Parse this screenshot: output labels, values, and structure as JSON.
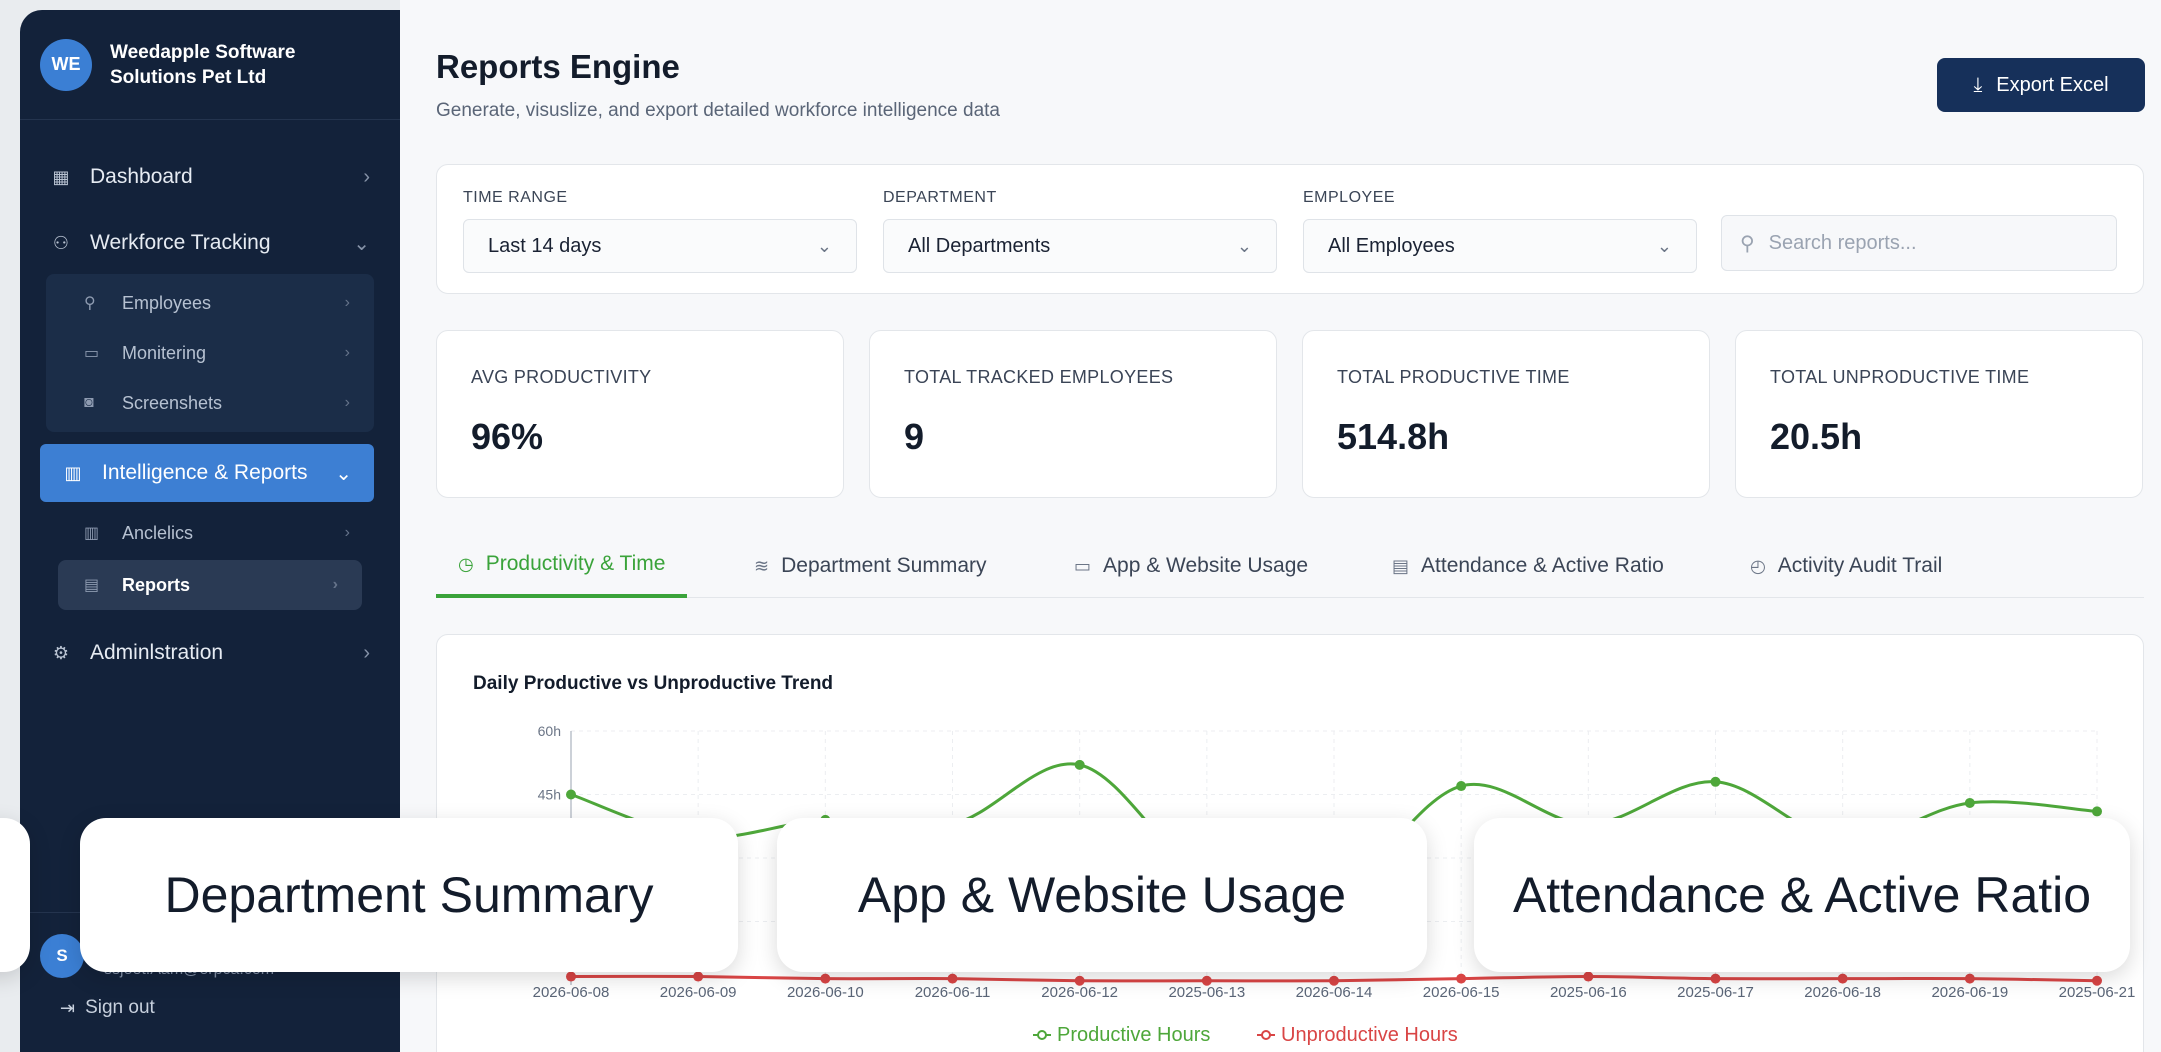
{
  "brand": {
    "logo": "WE",
    "name": "Weedapple Software Solutions Pet Ltd"
  },
  "nav": {
    "dashboard": "Dashboard",
    "workforce": "Werkforce Tracking",
    "employees": "Employees",
    "monitoring": "Monitering",
    "screenshots": "Screenshets",
    "intelligence": "Intelligence & Reports",
    "analytics": "Anclelics",
    "reports": "Reports",
    "administration": "Adminlstration"
  },
  "user": {
    "avatar": "S",
    "email": "ssjeet.Aam@erpca.com",
    "signout": "Sign out"
  },
  "header": {
    "title": "Reports Engine",
    "subtitle": "Generate, visuslize, and export detailed workforce intelligence data",
    "export": "Export Excel"
  },
  "filters": {
    "time_label": "TIME RANGE",
    "time_value": "Last 14 days",
    "dept_label": "DEPARTMENT",
    "dept_value": "All Departments",
    "emp_label": "EMPLOYEE",
    "emp_value": "All Employees",
    "search_placeholder": "Search reports..."
  },
  "stats": [
    {
      "label": "AVG PRODUCTIVITY",
      "value": "96%"
    },
    {
      "label": "TOTAL TRACKED EMPLOYEES",
      "value": "9"
    },
    {
      "label": "TOTAL PRODUCTIVE TIME",
      "value": "514.8h"
    },
    {
      "label": "TOTAL UNPRODUCTIVE TIME",
      "value": "20.5h"
    }
  ],
  "tabs": [
    "Productivity & Time",
    "Department Summary",
    "App & Website Usage",
    "Attendance & Active Ratio",
    "Activity Audit Trail"
  ],
  "overlay": [
    "Department Summary",
    "App & Website Usage",
    "Attendance & Active Ratio"
  ],
  "colors": {
    "productive": "#4ea73a",
    "unproductive": "#d94545",
    "accent": "#3d7fd3"
  },
  "chart_data": {
    "type": "line",
    "title": "Daily Productive vs Unproductive Trend",
    "x": [
      "2026-06-08",
      "2026-06-09",
      "2026-06-10",
      "2026-06-11",
      "2026-06-12",
      "2025-06-13",
      "2026-06-14",
      "2026-06-15",
      "2025-06-16",
      "2025-06-17",
      "2026-06-18",
      "2026-06-19",
      "2025-06-21"
    ],
    "ylim": [
      0,
      60
    ],
    "yticks": [
      "60h",
      "45h"
    ],
    "series": [
      {
        "name": "Productive Hours",
        "values": [
          45,
          35,
          39,
          38,
          52,
          25,
          22,
          47,
          38,
          48,
          34,
          43,
          41
        ]
      },
      {
        "name": "Unproductive Hours",
        "values": [
          2,
          2,
          1.5,
          1.5,
          1,
          1,
          1,
          1.5,
          2,
          1.5,
          1.5,
          1.5,
          1
        ]
      }
    ],
    "legend": "bottom"
  }
}
